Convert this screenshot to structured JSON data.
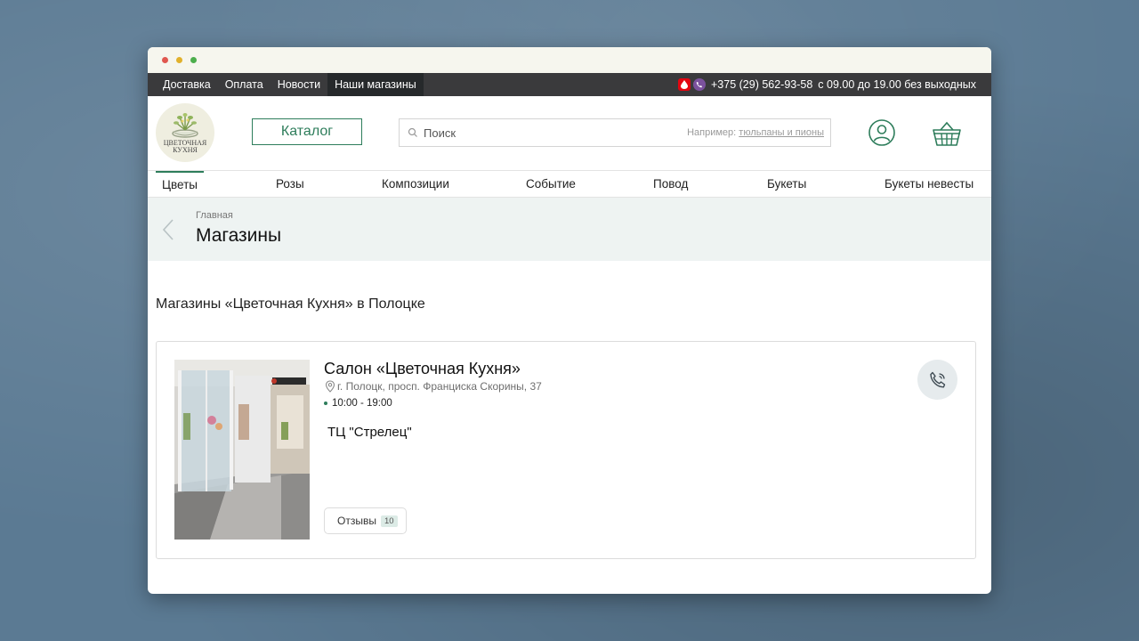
{
  "topbar": {
    "nav": [
      {
        "label": "Доставка",
        "active": false
      },
      {
        "label": "Оплата",
        "active": false
      },
      {
        "label": "Новости",
        "active": false
      },
      {
        "label": "Наши магазины",
        "active": true
      }
    ],
    "phone": "+375 (29) 562-93-58",
    "hours": "с 09.00 до 19.00 без выходных"
  },
  "header": {
    "logo_text_line1": "ЦВЕТОЧНАЯ",
    "logo_text_line2": "КУХНЯ",
    "catalog_label": "Каталог",
    "search_placeholder": "Поиск",
    "search_hint_prefix": "Например:",
    "search_hint_link": "тюльпаны и пионы",
    "icons": [
      "user-icon",
      "basket-icon"
    ]
  },
  "catnav": {
    "items": [
      "Цветы",
      "Розы",
      "Композиции",
      "Событие",
      "Повод",
      "Букеты",
      "Букеты невесты"
    ]
  },
  "breadcrumb": {
    "parent": "Главная",
    "title": "Магазины"
  },
  "section_title": "Магазины «Цветочная Кухня» в Полоцке",
  "store": {
    "name": "Салон «Цветочная Кухня»",
    "address": "г. Полоцк, просп. Франциска Скорины, 37",
    "hours": "10:00 - 19:00",
    "note": "ТЦ \"Стрелец\"",
    "reviews_label": "Отзывы",
    "reviews_count": "10"
  },
  "colors": {
    "accent": "#2e7d5b",
    "topbar_bg": "#3a3a3c",
    "breadcrumb_bg": "#eef3f2"
  }
}
